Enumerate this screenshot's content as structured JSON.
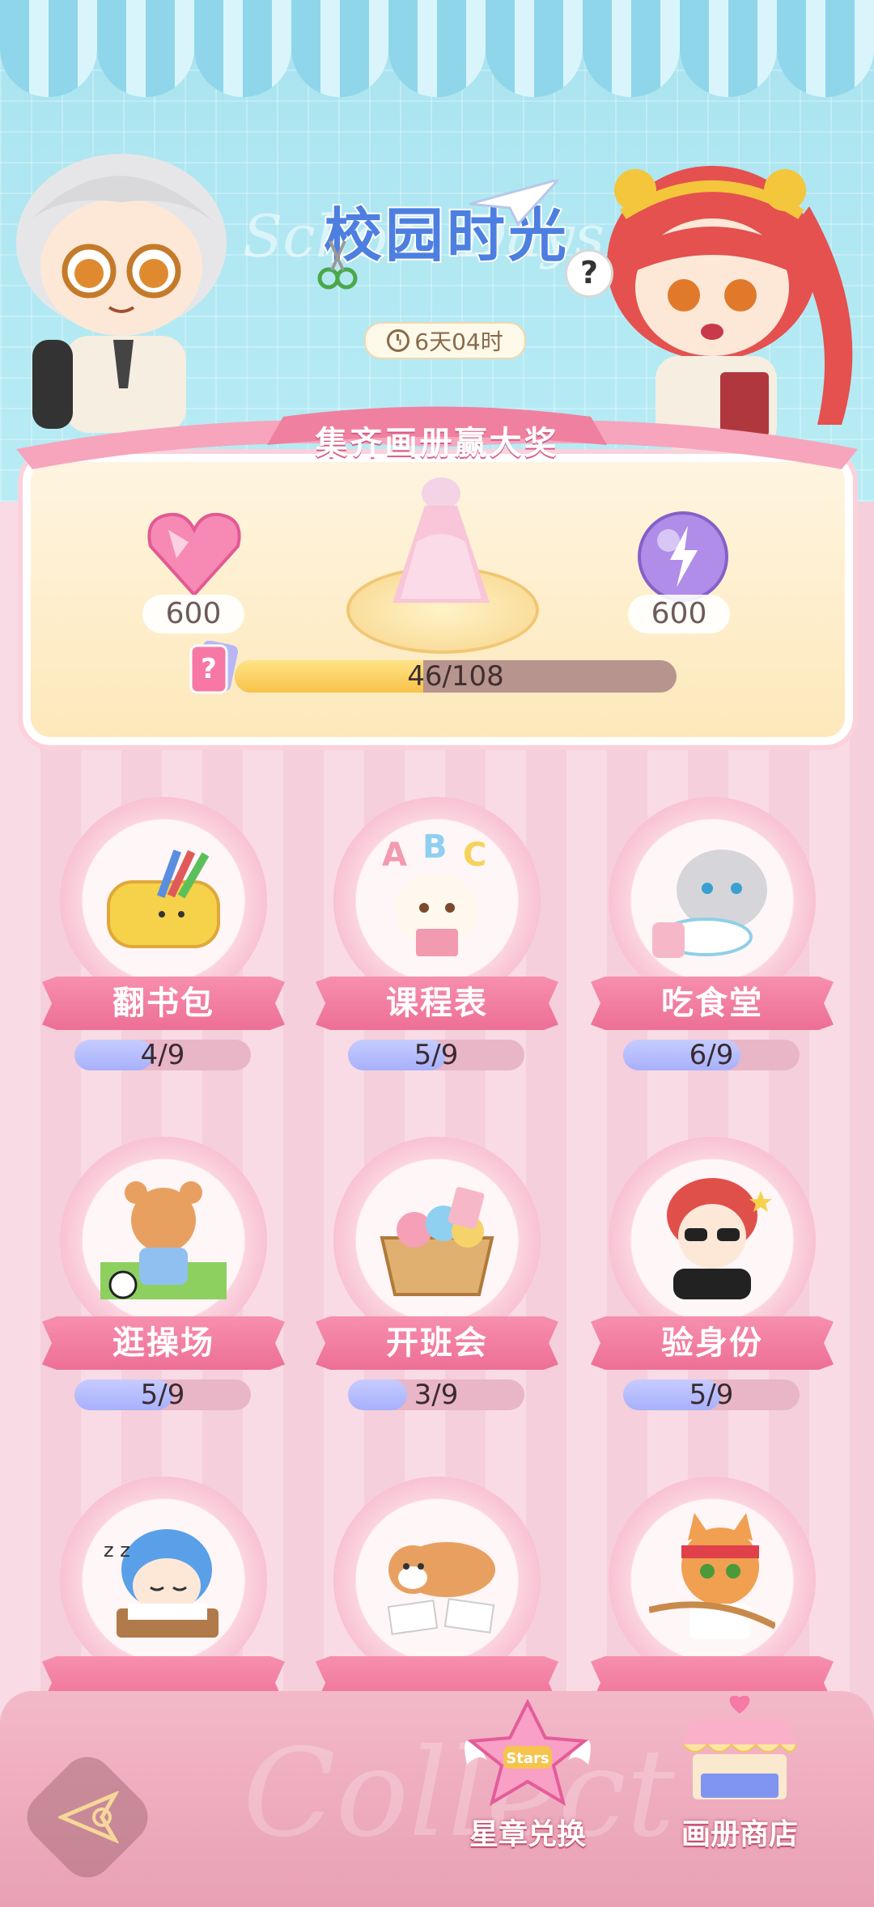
{
  "header": {
    "title": "校园时光",
    "subtitle_ghost": "School Days",
    "help_label": "?",
    "timer": "6天04时"
  },
  "banner": {
    "label": "集齐画册赢大奖"
  },
  "rewards": {
    "left_amount": "600",
    "right_amount": "600",
    "progress_text": "46/108",
    "progress_value": 46,
    "progress_max": 108
  },
  "tiles": [
    {
      "label": "翻书包",
      "count": "4/9",
      "done": 4,
      "total": 9,
      "art": "pencil-case-icon"
    },
    {
      "label": "课程表",
      "count": "5/9",
      "done": 5,
      "total": 9,
      "art": "abc-dog-icon"
    },
    {
      "label": "吃食堂",
      "count": "6/9",
      "done": 6,
      "total": 9,
      "art": "cat-rice-icon"
    },
    {
      "label": "逛操场",
      "count": "5/9",
      "done": 5,
      "total": 9,
      "art": "bear-soccer-icon"
    },
    {
      "label": "开班会",
      "count": "3/9",
      "done": 3,
      "total": 9,
      "art": "snack-basket-icon"
    },
    {
      "label": "验身份",
      "count": "5/9",
      "done": 5,
      "total": 9,
      "art": "sunglasses-boy-icon"
    },
    {
      "label": "",
      "count": "",
      "art": "sleeping-boy-icon"
    },
    {
      "label": "",
      "count": "",
      "art": "shiba-icon"
    },
    {
      "label": "",
      "count": "",
      "art": "headband-cat-icon"
    }
  ],
  "bottom": {
    "watermark": "Collect",
    "stars_badge": "Stars",
    "nav_exchange": "星章兑换",
    "nav_shop": "画册商店"
  },
  "colors": {
    "accent_pink": "#ed6f96",
    "progress_yellow": "#f8c24a",
    "progress_blue": "#a8b0fb",
    "sky": "#a9e3ef"
  }
}
